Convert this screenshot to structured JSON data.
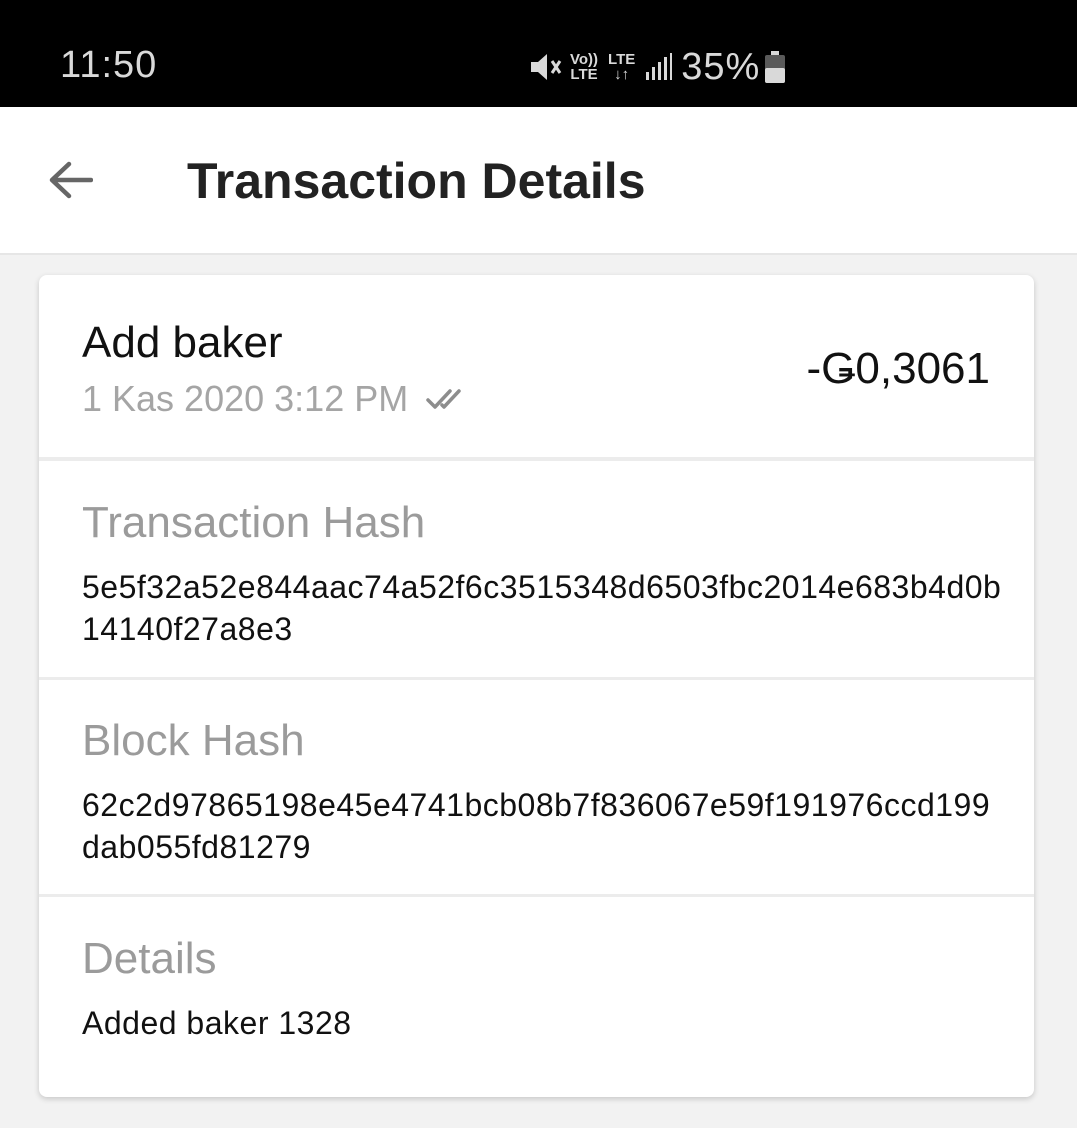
{
  "status_bar": {
    "time": "11:50",
    "battery_percent": "35%",
    "volte_top": "Vo))",
    "volte_bottom": "LTE",
    "network_top": "LTE",
    "network_bottom": "↓↑"
  },
  "header": {
    "title": "Transaction Details"
  },
  "transaction": {
    "title": "Add baker",
    "date": "1 Kas 2020 3:12 PM",
    "amount": "-Ǥ0,3061",
    "status_icon": "double-check-icon"
  },
  "sections": {
    "transaction_hash": {
      "label": "Transaction Hash",
      "value": "5e5f32a52e844aac74a52f6c3515348d6503fbc2014e683b4d0b14140f27a8e3"
    },
    "block_hash": {
      "label": "Block Hash",
      "value": "62c2d97865198e45e4741bcb08b7f836067e59f191976ccd199dab055fd81279"
    },
    "details": {
      "label": "Details",
      "value": "Added baker 1328"
    }
  },
  "colors": {
    "status_bar_bg": "#000000",
    "app_bar_bg": "#ffffff",
    "page_bg": "#f2f2f2",
    "label_gray": "#9b9b9b",
    "text_dark": "#111111"
  }
}
